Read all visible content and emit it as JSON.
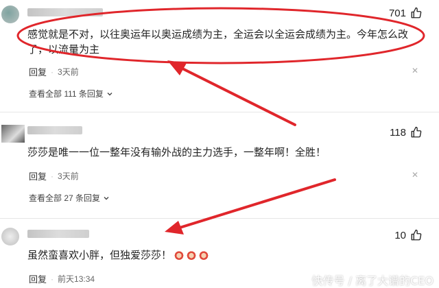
{
  "comments": [
    {
      "likes": "701",
      "text": "感觉就是不对，以往奥运年以奥运成绩为主，全运会以全运会成绩为主。今年怎么改了，以流量为主",
      "reply_label": "回复",
      "time": "3天前",
      "view_replies": "查看全部 111 条回复"
    },
    {
      "likes": "118",
      "text": "莎莎是唯一一位一整年没有输外战的主力选手，一整年啊！全胜！",
      "reply_label": "回复",
      "time": "3天前",
      "view_replies": "查看全部 27 条回复"
    },
    {
      "likes": "10",
      "text": "虽然蛮喜欢小胖，但独爱莎莎！",
      "reply_label": "回复",
      "time": "前天13:34"
    }
  ],
  "icons": {
    "like": "thumbs-up-icon",
    "close": "close-icon",
    "chevron": "chevron-down-icon",
    "emoji": "ping-pong-paddle-emoji"
  },
  "colors": {
    "annotation_red": "#e0262b",
    "muted_text": "#666666"
  },
  "watermark": "快传号 / 离了大谱的CEO"
}
